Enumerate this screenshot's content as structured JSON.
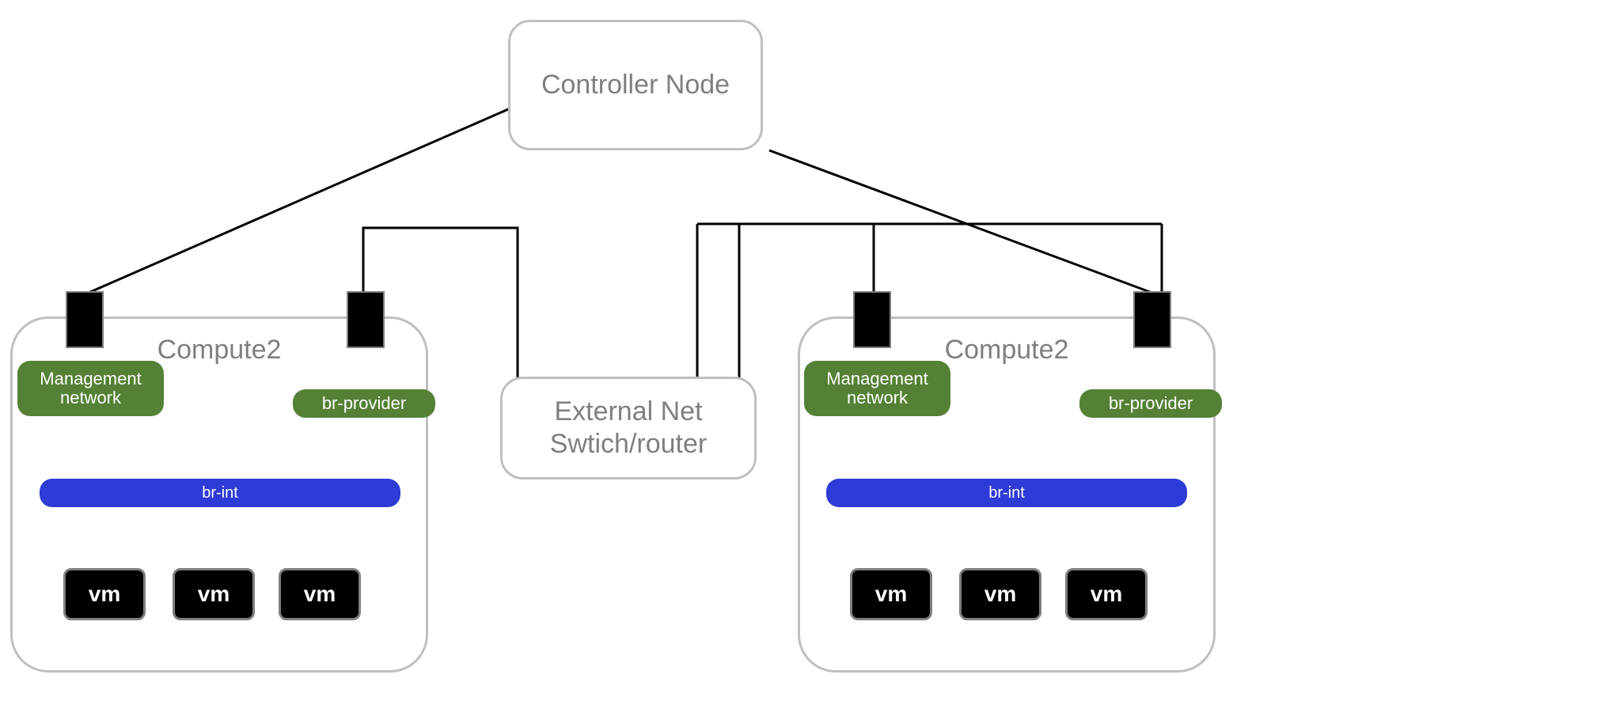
{
  "controller": {
    "label": "Controller Node"
  },
  "external": {
    "label": "External Net\nSwtich/router"
  },
  "compute_left": {
    "title": "Compute2",
    "mgmt": "Management\nnetwork",
    "provider": "br-provider",
    "brint": "br-int",
    "vms": [
      "vm",
      "vm",
      "vm"
    ]
  },
  "compute_right": {
    "title": "Compute2",
    "mgmt": "Management\nnetwork",
    "provider": "br-provider",
    "brint": "br-int",
    "vms": [
      "vm",
      "vm",
      "vm"
    ]
  },
  "colors": {
    "green": "#548135",
    "blue": "#2e3bd6",
    "grey": "#bfbfbf",
    "black": "#000000"
  }
}
